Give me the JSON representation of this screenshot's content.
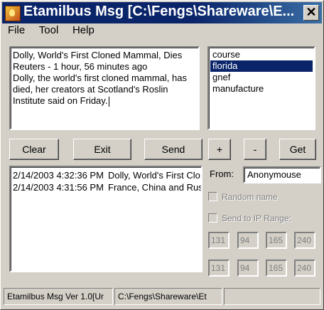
{
  "window": {
    "title": "Etamilbus Msg [C:\\Fengs\\Shareware\\E..."
  },
  "menu": {
    "items": [
      "File",
      "Tool",
      "Help"
    ]
  },
  "message": {
    "lines": [
      "Dolly, World's First Cloned Mammal, Dies",
      "Reuters - 1 hour, 56 minutes ago",
      "Dolly, the world's first cloned mammal, has",
      "died, her creators at Scotland's Roslin",
      "Institute said on Friday."
    ]
  },
  "topics": {
    "items": [
      "course",
      "florida",
      "gnef",
      "manufacture"
    ],
    "selected": "florida"
  },
  "buttons": {
    "clear": "Clear",
    "exit": "Exit",
    "send": "Send",
    "plus": "+",
    "minus": "-",
    "get": "Get"
  },
  "log": {
    "rows": [
      {
        "time": "2/14/2003 4:32:36 PM",
        "text": "Dolly, World's First Clo"
      },
      {
        "time": "2/14/2003 4:31:56 PM",
        "text": "France, China and Rus"
      }
    ]
  },
  "from": {
    "label": "From:",
    "value": "Anonymouse"
  },
  "options": {
    "random_name": "Random name",
    "ip_range": "Send to IP Range:"
  },
  "ip_range": {
    "start": [
      "131",
      "94",
      "165",
      "240"
    ],
    "end": [
      "131",
      "94",
      "165",
      "240"
    ]
  },
  "status": {
    "version": "Etamilbus Msg Ver 1.0[Ur",
    "path": "C:\\Fengs\\Shareware\\Et",
    "extra": ""
  }
}
